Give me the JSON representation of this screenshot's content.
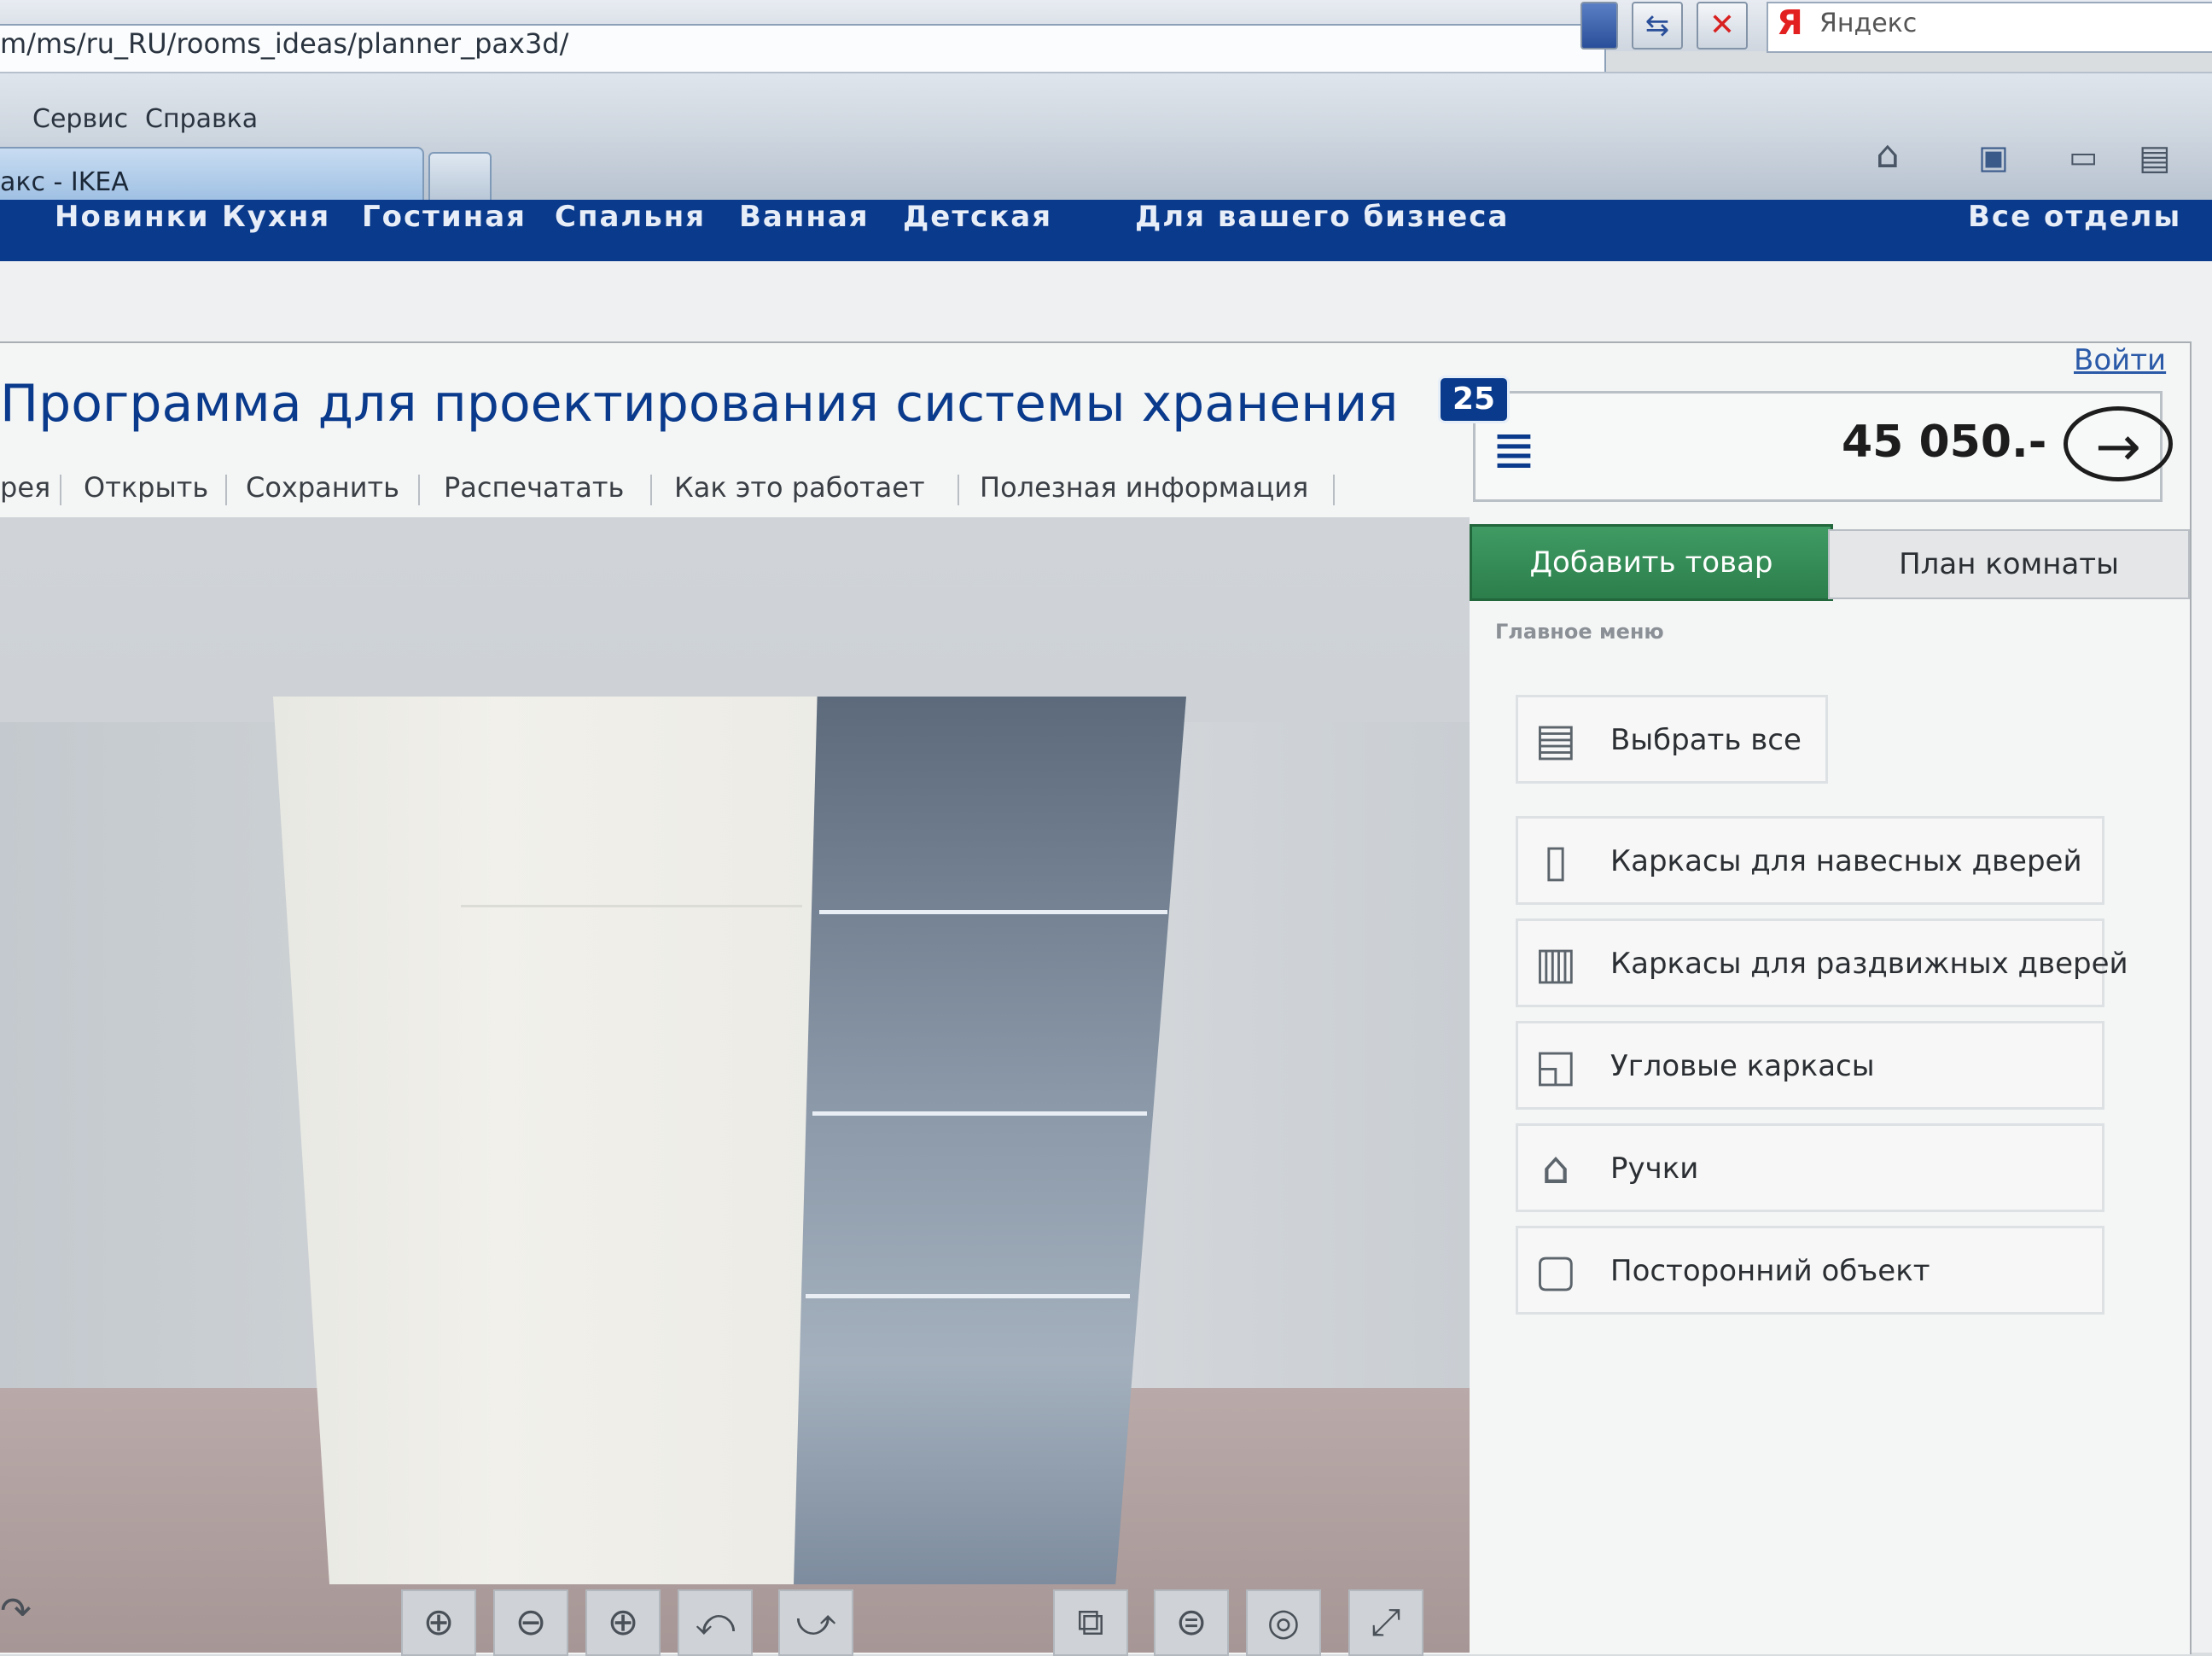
{
  "browser": {
    "url": "m/ms/ru_RU/rooms_ideas/planner_pax3d/",
    "search_engine": "Яндекс",
    "menu": [
      "Сервис",
      "Справка"
    ],
    "tab_title": "акс - IKEA"
  },
  "site_nav": [
    "Новинки",
    "Кухня",
    "Гостиная",
    "Спальня",
    "Ванная",
    "Детская",
    "Для вашего бизнеса",
    "Все отделы"
  ],
  "header": {
    "title": "Программа для проектирования системы хранения",
    "login": "Войти",
    "item_count": "25",
    "cart_total": "45 050.-"
  },
  "toolbar": {
    "items": [
      "рея",
      "Открыть",
      "Сохранить",
      "Распечатать",
      "Как это работает",
      "Полезная информация"
    ]
  },
  "panel": {
    "tab_add": "Добавить товар",
    "tab_plan": "План комнаты",
    "menu_title": "Главное меню",
    "menu_items": [
      {
        "label": "Выбрать все",
        "icon": "select-all-icon"
      },
      {
        "label": "Каркасы для навесных дверей",
        "icon": "hinged-frame-icon"
      },
      {
        "label": "Каркасы для раздвижных дверей",
        "icon": "sliding-frame-icon"
      },
      {
        "label": "Угловые каркасы",
        "icon": "corner-frame-icon"
      },
      {
        "label": "Ручки",
        "icon": "handles-icon"
      },
      {
        "label": "Посторонний объект",
        "icon": "foreign-object-icon"
      }
    ]
  },
  "colors": {
    "ikea_blue": "#0a3a8c",
    "active_tab_green": "#2c7e4b"
  }
}
